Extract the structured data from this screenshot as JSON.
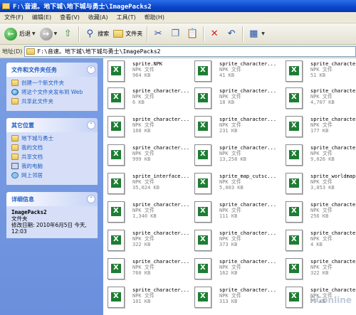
{
  "window": {
    "title": "F:\\音速。地下城\\地下城与勇士\\ImagePacks2"
  },
  "menu": [
    "文件(F)",
    "编辑(E)",
    "查看(V)",
    "收藏(A)",
    "工具(T)",
    "帮助(H)"
  ],
  "toolbar": {
    "back": "后退",
    "search": "搜索",
    "folders": "文件夹"
  },
  "address": {
    "label": "地址(D)",
    "value": "F:\\音速。地下城\\地下城与勇士\\ImagePacks2"
  },
  "sidebar": {
    "tasks": {
      "title": "文件和文件夹任务",
      "items": [
        "创建一个新文件夹",
        "将这个文件夹发布到 Web",
        "共享此文件夹"
      ]
    },
    "places": {
      "title": "其它位置",
      "items": [
        "地下城与勇士",
        "我的文档",
        "共享文档",
        "我的电脑",
        "网上邻居"
      ]
    },
    "details": {
      "title": "详细信息",
      "name": "ImagePacks2",
      "type": "文件夹",
      "modified": "修改日期: 2010年6月5日 今天, 12:03"
    }
  },
  "files": [
    {
      "name": "sprite.NPK",
      "type": "NPK 文件",
      "size": "964 KB"
    },
    {
      "name": "sprite_character...",
      "type": "NPK 文件",
      "size": "41 KB"
    },
    {
      "name": "sprite_character...",
      "type": "NPK 文件",
      "size": "51 KB"
    },
    {
      "name": "sprite_character...",
      "type": "NPK 文件",
      "size": "6 KB"
    },
    {
      "name": "sprite_character...",
      "type": "NPK 文件",
      "size": "18 KB"
    },
    {
      "name": "sprite_character...",
      "type": "NPK 文件",
      "size": "4,707 KB"
    },
    {
      "name": "sprite_character...",
      "type": "NPK 文件",
      "size": "160 KB"
    },
    {
      "name": "sprite_character...",
      "type": "NPK 文件",
      "size": "231 KB"
    },
    {
      "name": "sprite_character...",
      "type": "NPK 文件",
      "size": "177 KB"
    },
    {
      "name": "sprite_character...",
      "type": "NPK 文件",
      "size": "999 KB"
    },
    {
      "name": "sprite_character...",
      "type": "NPK 文件",
      "size": "13,258 KB"
    },
    {
      "name": "sprite_character...",
      "type": "NPK 文件",
      "size": "9,026 KB"
    },
    {
      "name": "sprite_interface...",
      "type": "NPK 文件",
      "size": "35,024 KB"
    },
    {
      "name": "sprite_map_cutsc...",
      "type": "NPK 文件",
      "size": "5,003 KB"
    },
    {
      "name": "sprite_worldmap...",
      "type": "NPK 文件",
      "size": "3,053 KB"
    },
    {
      "name": "sprite_character...",
      "type": "NPK 文件",
      "size": "1,340 KB"
    },
    {
      "name": "sprite_character...",
      "type": "NPK 文件",
      "size": "111 KB"
    },
    {
      "name": "sprite_character...",
      "type": "NPK 文件",
      "size": "256 KB"
    },
    {
      "name": "sprite_character...",
      "type": "NPK 文件",
      "size": "322 KB"
    },
    {
      "name": "sprite_character...",
      "type": "NPK 文件",
      "size": "373 KB"
    },
    {
      "name": "sprite_character...",
      "type": "NPK 文件",
      "size": "4 KB"
    },
    {
      "name": "sprite_character...",
      "type": "NPK 文件",
      "size": "760 KB"
    },
    {
      "name": "sprite_character...",
      "type": "NPK 文件",
      "size": "162 KB"
    },
    {
      "name": "sprite_character...",
      "type": "NPK 文件",
      "size": "322 KB"
    },
    {
      "name": "sprite_character...",
      "type": "NPK 文件",
      "size": "101 KB"
    },
    {
      "name": "sprite_character...",
      "type": "NPK 文件",
      "size": "313 KB"
    },
    {
      "name": "sprite_character...",
      "type": "NPK 文件",
      "size": "76 KB"
    }
  ],
  "watermark": "PConline"
}
